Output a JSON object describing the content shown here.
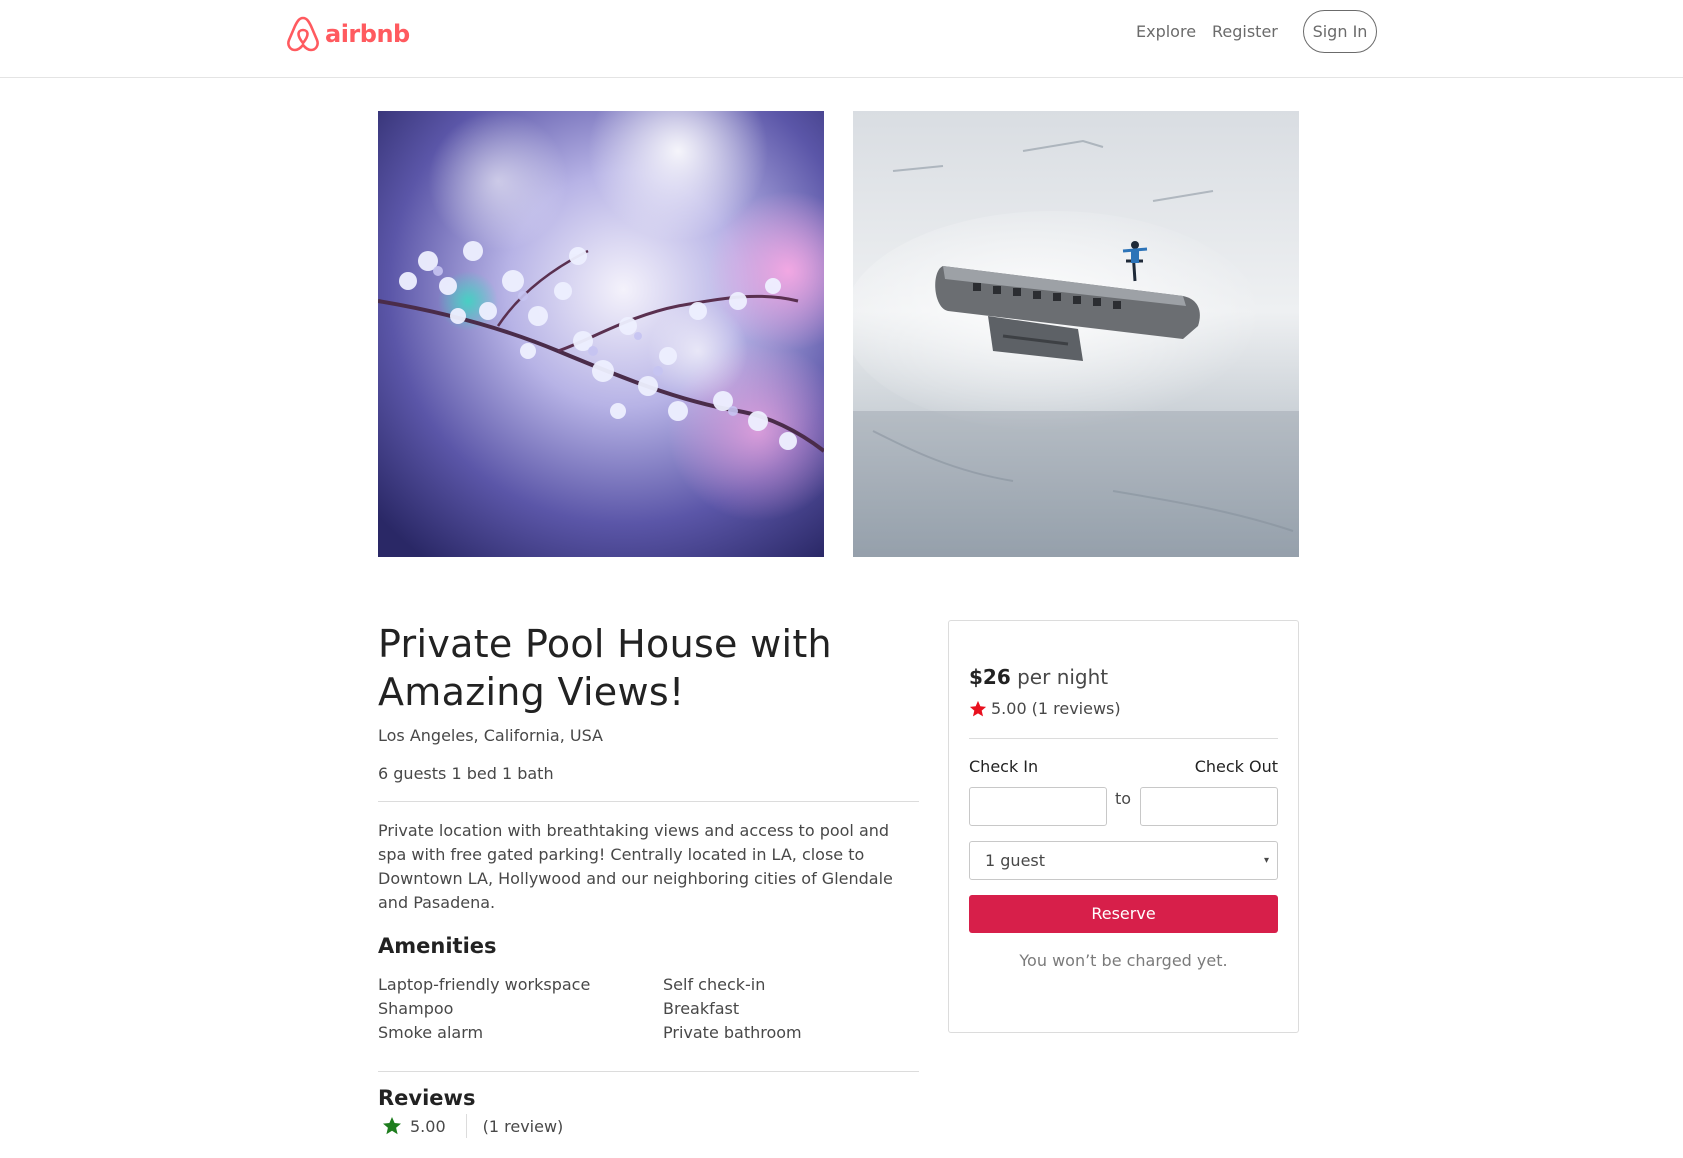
{
  "header": {
    "logo_text": "airbnb",
    "nav": {
      "explore": "Explore",
      "register": "Register",
      "sign_in": "Sign In"
    }
  },
  "photos": [
    {
      "name": "cherry-blossom-photo",
      "description_icon": "blossom-branch"
    },
    {
      "name": "plane-wreck-snow-photo",
      "description_icon": "plane-wreck"
    }
  ],
  "listing": {
    "title": "Private Pool House with Amazing Views!",
    "location": "Los Angeles, California, USA",
    "specs": "6 guests 1 bed 1 bath",
    "description": "Private location with breathtaking views and access to pool and spa with free gated parking! Centrally located in LA, close to Downtown LA, Hollywood and our neighboring cities of Glendale and Pasadena.",
    "amenities_title": "Amenities",
    "amenities": [
      "Laptop-friendly workspace",
      "Self check-in",
      "Shampoo",
      "Breakfast",
      "Smoke alarm",
      "Private bathroom"
    ],
    "reviews_title": "Reviews",
    "reviews_rating": "5.00",
    "reviews_count": "(1 review)"
  },
  "booking": {
    "price": "$26",
    "per_night": "per night",
    "rating": "5.00",
    "reviews": "(1 reviews)",
    "check_in_label": "Check In",
    "check_out_label": "Check Out",
    "to_label": "to",
    "guests_selected": "1 guest",
    "reserve_label": "Reserve",
    "note": "You won’t be charged yet."
  },
  "colors": {
    "brand": "#ff5a5f",
    "reserve": "#d71f4a",
    "card_star": "#e8101e",
    "review_star": "#1e7d1e"
  }
}
